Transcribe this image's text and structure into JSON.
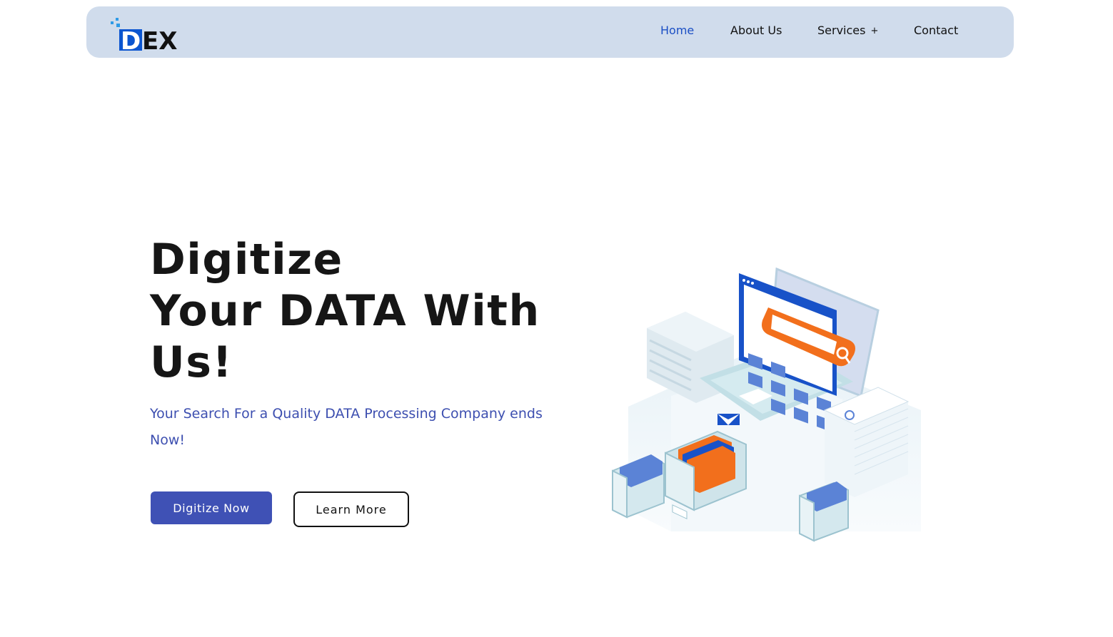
{
  "brand": {
    "logo_text": "DEX",
    "accent_color": "#1b4fc4",
    "nav_bg_color": "#d0dcec"
  },
  "nav": {
    "items": [
      {
        "label": "Home",
        "active": true
      },
      {
        "label": "About Us",
        "active": false
      },
      {
        "label": "Services",
        "active": false,
        "expand_icon": "+"
      },
      {
        "label": "Contact",
        "active": false
      }
    ]
  },
  "hero": {
    "title_lines": [
      "Digitize",
      "Your DATA With",
      "Us!"
    ],
    "subtitle": "Your Search For a Quality DATA Processing Company ends Now!",
    "primary_button": "Digitize Now",
    "secondary_button": "Learn More",
    "primary_color": "#3f51b5",
    "illustration_icon": "data-digitization-illustration"
  }
}
